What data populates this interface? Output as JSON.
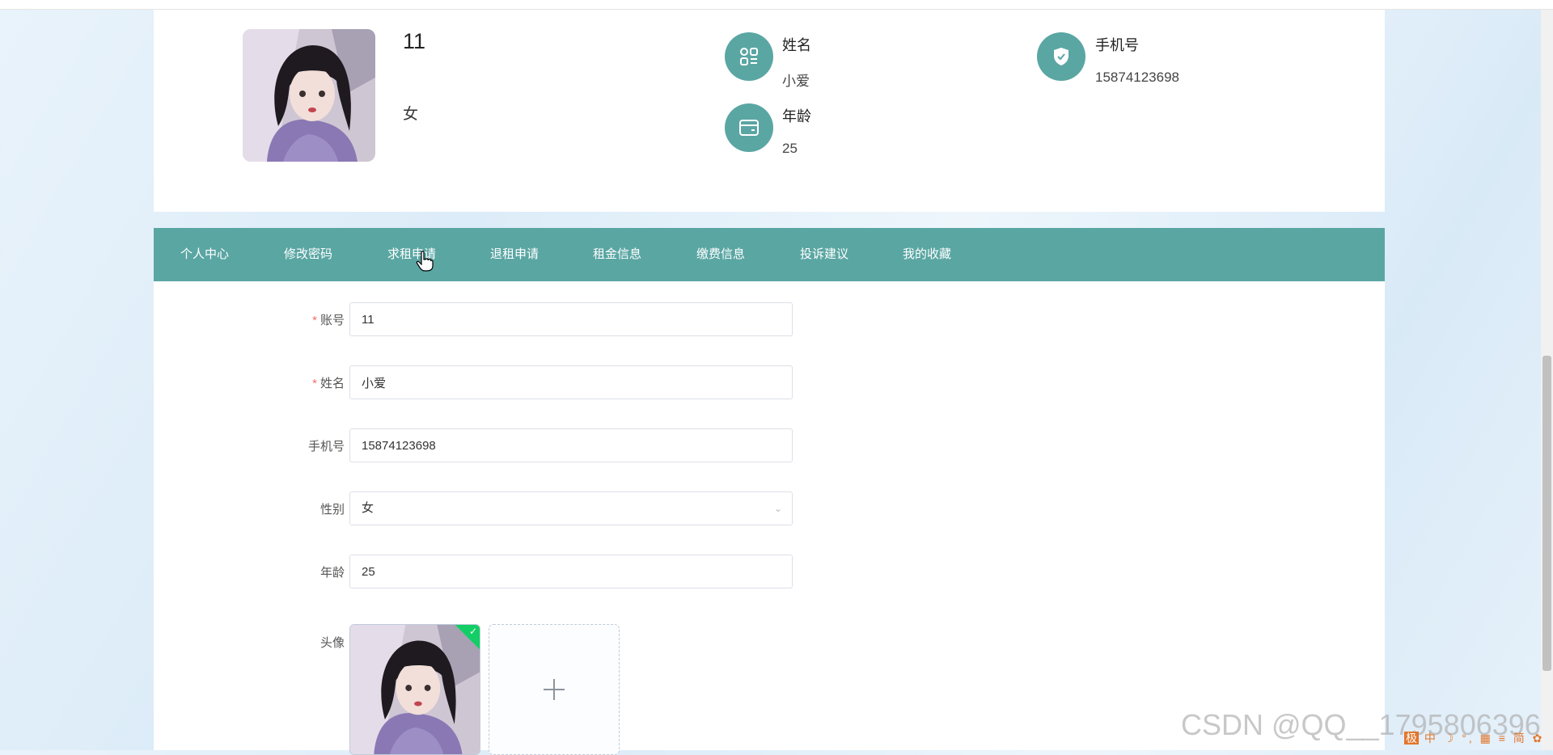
{
  "profile": {
    "account": "11",
    "gender": "女",
    "name_label": "姓名",
    "name_value": "小爱",
    "phone_label": "手机号",
    "phone_value": "15874123698",
    "age_label": "年龄",
    "age_value": "25"
  },
  "nav": {
    "tabs": [
      "个人中心",
      "修改密码",
      "求租申请",
      "退租申请",
      "租金信息",
      "缴费信息",
      "投诉建议",
      "我的收藏"
    ]
  },
  "form": {
    "account_label": "账号",
    "account_value": "11",
    "name_label": "姓名",
    "name_value": "小爱",
    "phone_label": "手机号",
    "phone_value": "15874123698",
    "gender_label": "性别",
    "gender_value": "女",
    "age_label": "年龄",
    "age_value": "25",
    "avatar_label": "头像",
    "required_mark": "*",
    "add_symbol": "+",
    "success_symbol": "✓"
  },
  "watermark": "CSDN @QQ__1795806396",
  "ime": {
    "text": "中 ☽ °, ▦ ≡ 简 ✿",
    "logo": "极"
  },
  "colors": {
    "accent": "#5aa6a3",
    "success": "#13ce66",
    "required": "#f56c6c"
  }
}
